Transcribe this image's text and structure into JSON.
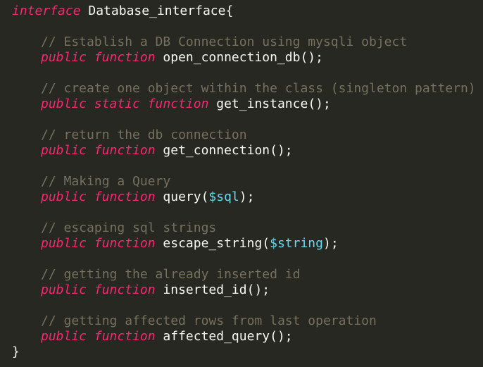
{
  "editor": {
    "colors": {
      "background": "#272822",
      "keyword": "#f92672",
      "comment": "#75715e",
      "variable": "#66d9ef",
      "text": "#f8f8f2"
    },
    "header": {
      "keyword": "interface",
      "name": " Database_interface{"
    },
    "methods": [
      {
        "comment": "// Establish a DB Connection using mysqli object",
        "modifiers": "public function",
        "name": " open_connection_db",
        "param": "",
        "tail": "();"
      },
      {
        "comment": "// create one object within the class (singleton pattern)",
        "modifiers": "public static function",
        "name": " get_instance",
        "param": "",
        "tail": "();"
      },
      {
        "comment": "// return the db connection",
        "modifiers": "public function",
        "name": " get_connection",
        "param": "",
        "tail": "();"
      },
      {
        "comment": "// Making a Query",
        "modifiers": "public function",
        "name": " query(",
        "param": "$sql",
        "tail": ");"
      },
      {
        "comment": "// escaping sql strings",
        "modifiers": "public function",
        "name": " escape_string(",
        "param": "$string",
        "tail": ");"
      },
      {
        "comment": "// getting the already inserted id",
        "modifiers": "public function",
        "name": " inserted_id",
        "param": "",
        "tail": "();"
      },
      {
        "comment": "// getting affected rows from last operation",
        "modifiers": "public function",
        "name": " affected_query",
        "param": "",
        "tail": "();"
      }
    ],
    "footer": "}"
  }
}
